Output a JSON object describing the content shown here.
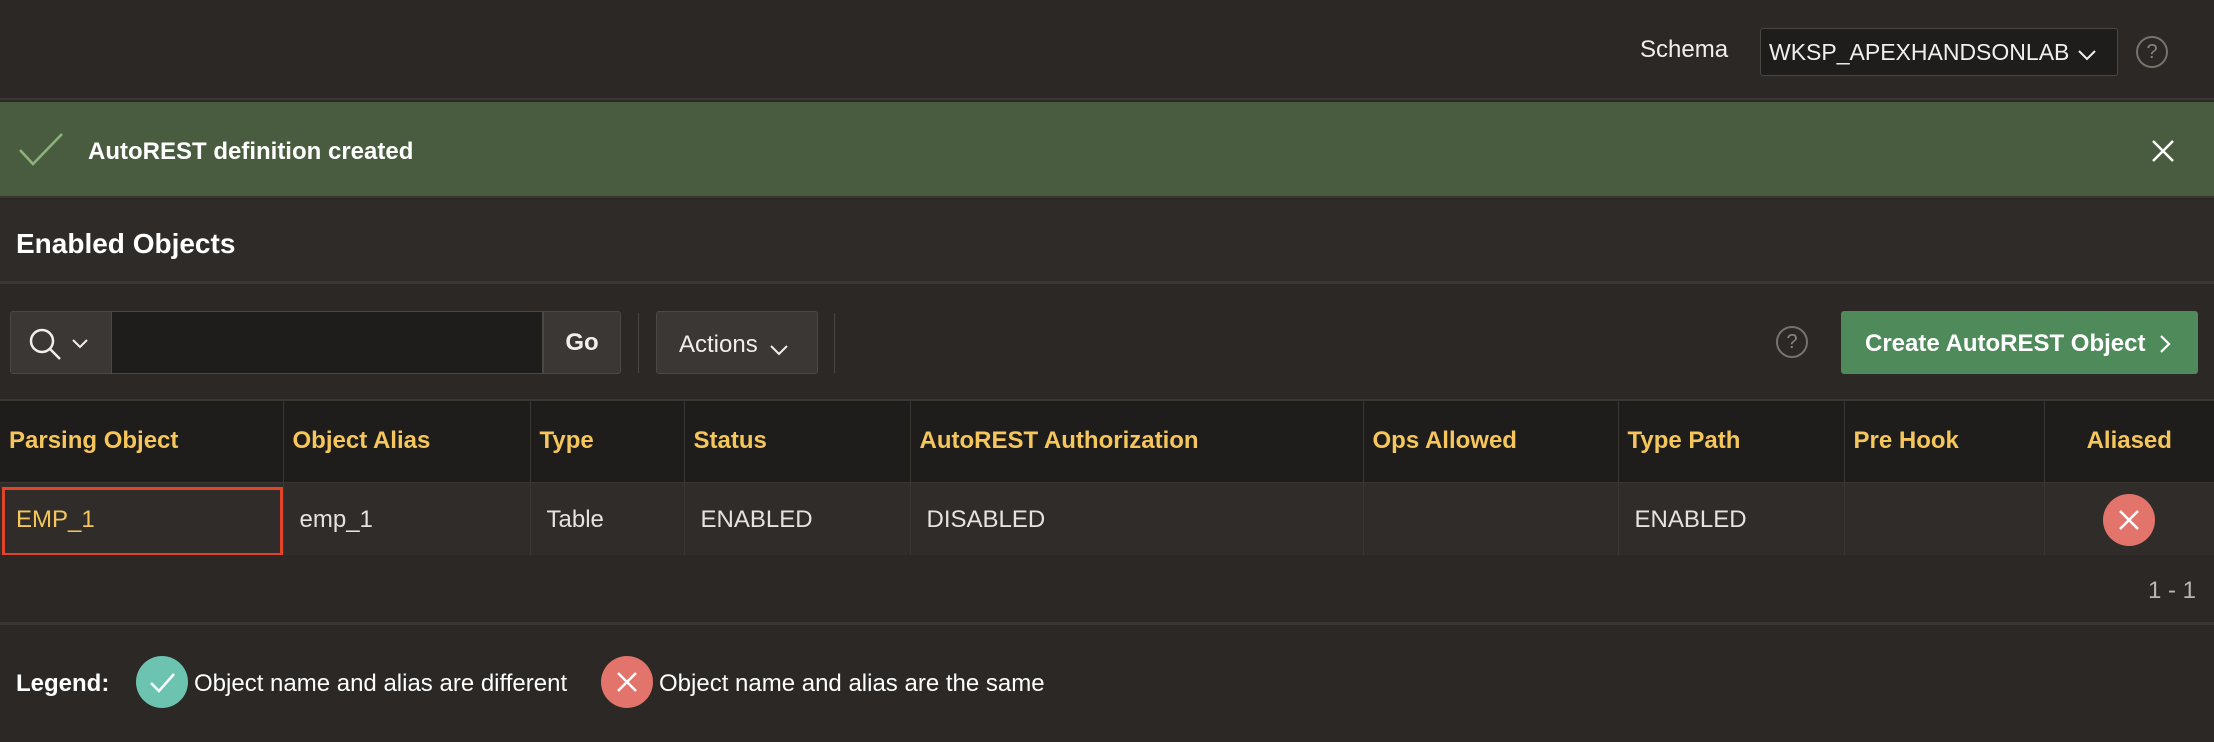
{
  "header": {
    "schema_label": "Schema",
    "schema_value": "WKSP_APEXHANDSONLAB",
    "help_glyph": "?"
  },
  "alert": {
    "message": "AutoREST definition created",
    "color": "#4a5c3f"
  },
  "region": {
    "title": "Enabled Objects"
  },
  "toolbar": {
    "search_value": "",
    "go_label": "Go",
    "actions_label": "Actions",
    "create_label": "Create AutoREST Object",
    "help_glyph": "?",
    "accent_color": "#4e8a5a"
  },
  "table": {
    "columns": [
      "Parsing Object",
      "Object Alias",
      "Type",
      "Status",
      "AutoREST Authorization",
      "Ops Allowed",
      "Type Path",
      "Pre Hook",
      "Aliased"
    ],
    "rows": [
      {
        "parsing_object": "EMP_1",
        "object_alias": "emp_1",
        "type": "Table",
        "status": "ENABLED",
        "autorest_authorization": "DISABLED",
        "ops_allowed": "",
        "type_path": "ENABLED",
        "pre_hook": "",
        "aliased_icon": "x-circle-icon"
      }
    ],
    "pagination": "1 - 1",
    "header_text_color": "#f5c65b"
  },
  "legend": {
    "label": "Legend:",
    "items": [
      {
        "icon": "check-circle-icon",
        "text": "Object name and alias are different",
        "color": "#6cc3b0"
      },
      {
        "icon": "x-circle-icon",
        "text": "Object name and alias are the same",
        "color": "#e3746b"
      }
    ]
  }
}
